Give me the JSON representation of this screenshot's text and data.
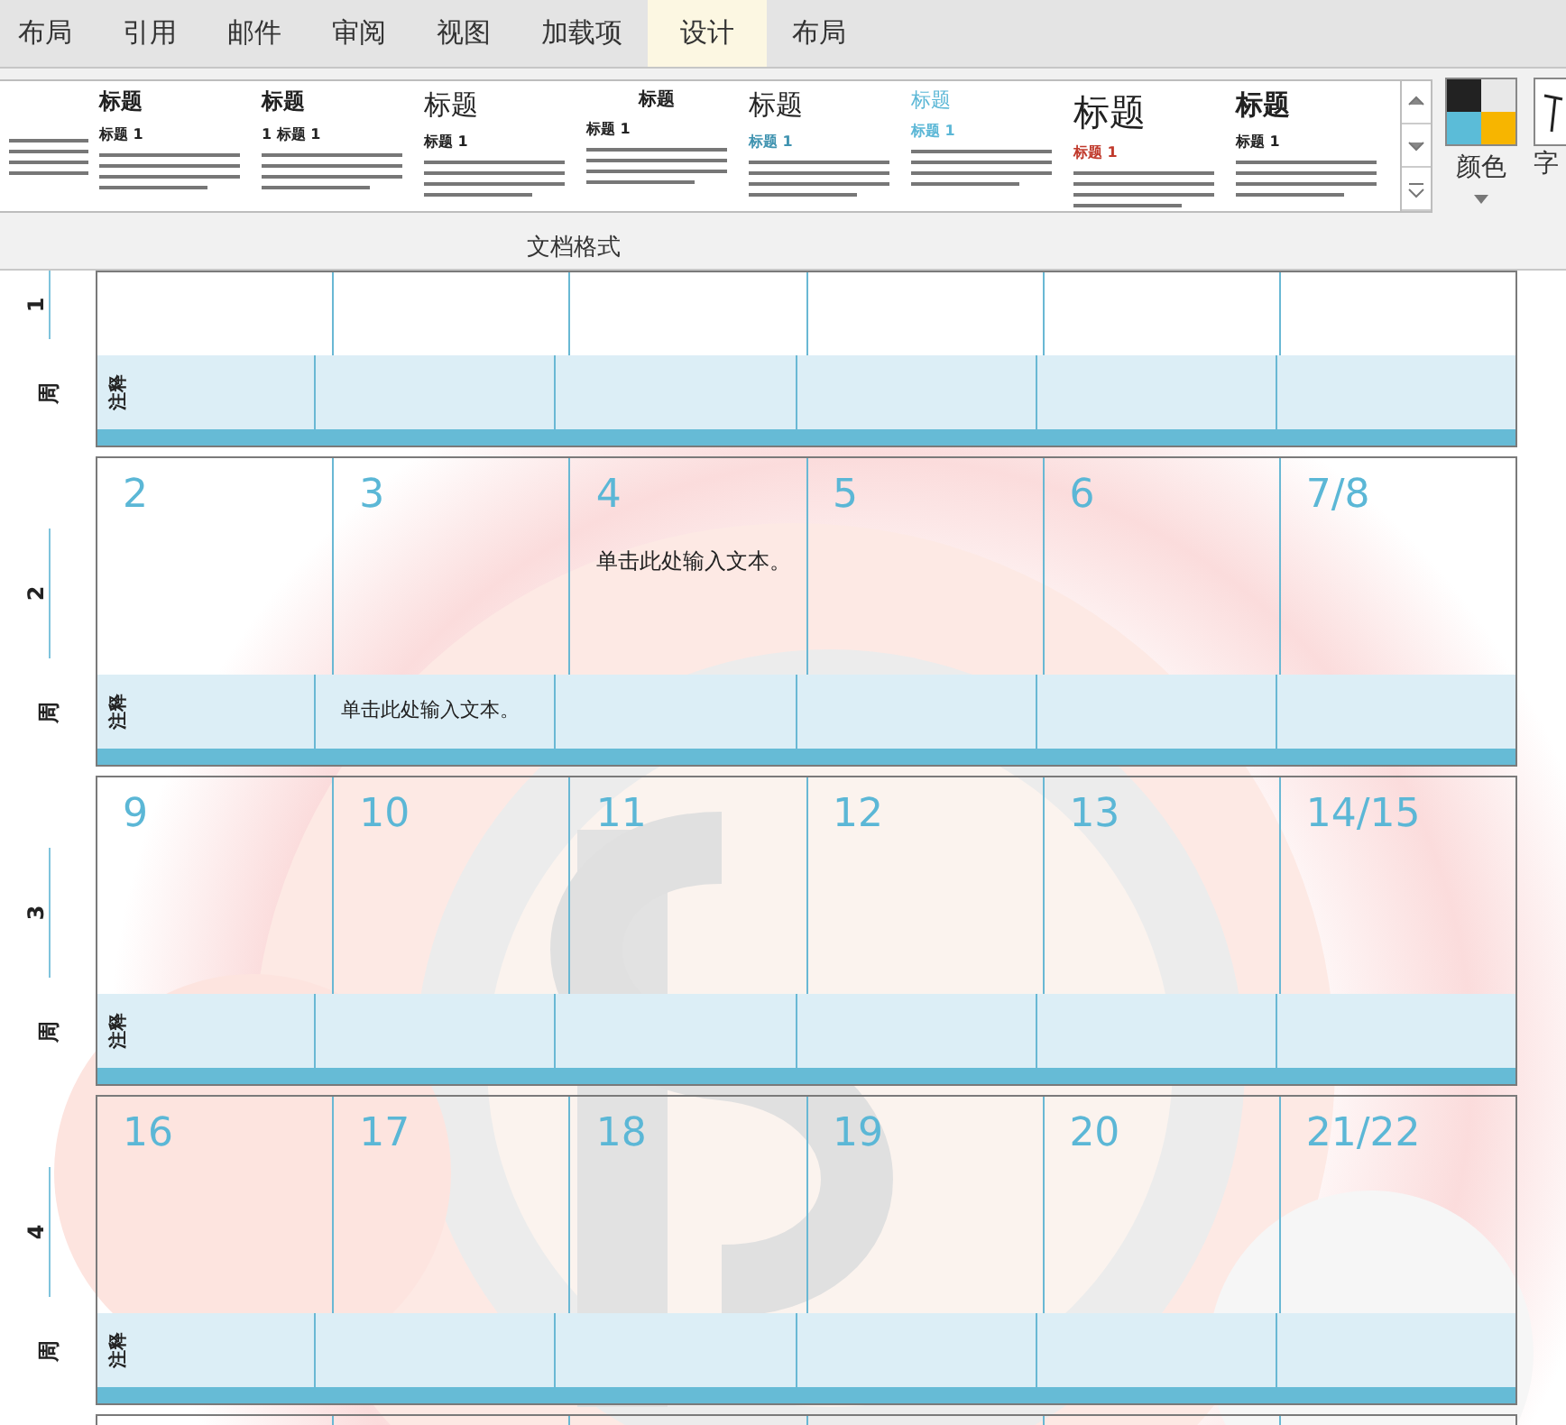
{
  "ribbon_tabs": [
    {
      "label": "布局",
      "selected": false
    },
    {
      "label": "引用",
      "selected": false
    },
    {
      "label": "邮件",
      "selected": false
    },
    {
      "label": "审阅",
      "selected": false
    },
    {
      "label": "视图",
      "selected": false
    },
    {
      "label": "加载项",
      "selected": false
    },
    {
      "label": "设计",
      "selected": true
    },
    {
      "label": "布局",
      "selected": false
    }
  ],
  "style_gallery": {
    "group_label": "文档格式",
    "items": [
      {
        "kind": "left"
      },
      {
        "kind": "plain",
        "title": "标题",
        "heading": "标题 1"
      },
      {
        "kind": "numbered",
        "title": "标题",
        "heading": "1  标题 1"
      },
      {
        "kind": "large",
        "title": "标题",
        "heading": "标题 1"
      },
      {
        "kind": "center",
        "title": "标题",
        "heading": "标题 1"
      },
      {
        "kind": "accent",
        "title": "标题",
        "heading": "标题 1"
      },
      {
        "kind": "accent-light",
        "title": "标题",
        "heading": "标题 1"
      },
      {
        "kind": "big",
        "title": "标题",
        "heading": "标题 1"
      },
      {
        "kind": "bold",
        "title": "标题",
        "heading": "标题 1"
      }
    ]
  },
  "colors_button": {
    "label": "颜色"
  },
  "fonts_button": {
    "label": "字"
  },
  "weeks": [
    {
      "kind": "cut_top",
      "week_label": "周",
      "week_number": "1",
      "notes_label": "注释"
    },
    {
      "kind": "full",
      "week_label": "周",
      "week_number": "2",
      "notes_label": "注释",
      "days": [
        {
          "date": "2"
        },
        {
          "date": "3",
          "note": "单击此处输入文本。"
        },
        {
          "date": "4",
          "text": "单击此处输入文本。"
        },
        {
          "date": "5"
        },
        {
          "date": "6"
        },
        {
          "date": "7/8"
        }
      ]
    },
    {
      "kind": "full",
      "week_label": "周",
      "week_number": "3",
      "notes_label": "注释",
      "days": [
        {
          "date": "9"
        },
        {
          "date": "10"
        },
        {
          "date": "11"
        },
        {
          "date": "12"
        },
        {
          "date": "13"
        },
        {
          "date": "14/15"
        }
      ]
    },
    {
      "kind": "full",
      "week_label": "周",
      "week_number": "4",
      "notes_label": "注释",
      "days": [
        {
          "date": "16"
        },
        {
          "date": "17"
        },
        {
          "date": "18"
        },
        {
          "date": "19"
        },
        {
          "date": "20"
        },
        {
          "date": "21/22"
        }
      ]
    },
    {
      "kind": "cut_bottom"
    }
  ]
}
